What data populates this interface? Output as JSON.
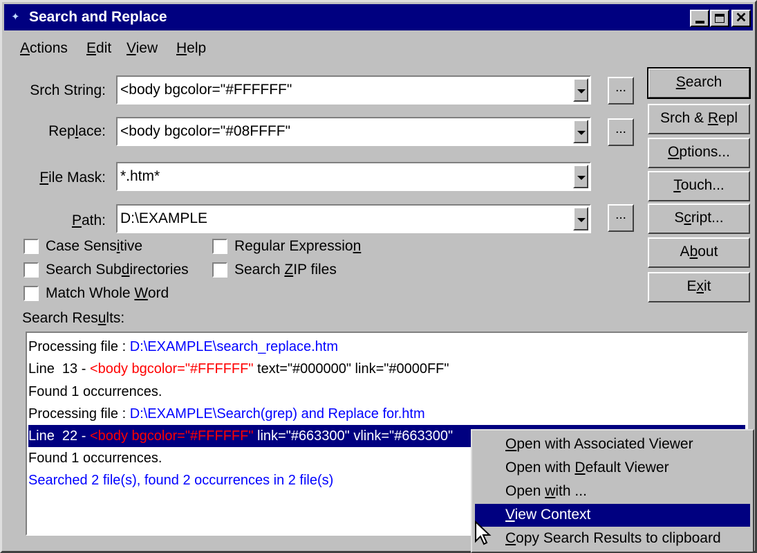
{
  "window": {
    "title": "Search and Replace",
    "icon": "app-icon"
  },
  "menu": [
    {
      "label": "Actions",
      "key": "A"
    },
    {
      "label": "Edit",
      "key": "E"
    },
    {
      "label": "View",
      "key": "V"
    },
    {
      "label": "Help",
      "key": "H"
    }
  ],
  "form": {
    "srch_string": {
      "label": "Srch String:",
      "value": "<body bgcolor=\"#FFFFFF\""
    },
    "replace": {
      "label": "Replace:",
      "value": "<body bgcolor=\"#08FFFF\""
    },
    "file_mask": {
      "label": "File Mask:",
      "value": "*.htm*"
    },
    "path": {
      "label": "Path:",
      "value": "D:\\EXAMPLE"
    },
    "browse_label": "..."
  },
  "options": {
    "case_sensitive": "Case Sensitive",
    "regular_expression": "Regular Expression",
    "search_subdirectories": "Search Subdirectories",
    "search_zip": "Search ZIP files",
    "match_whole_word": "Match Whole Word"
  },
  "buttons": {
    "search": "Search",
    "srch_repl": "Srch & Repl",
    "options": "Options...",
    "touch": "Touch...",
    "script": "Script...",
    "about": "About",
    "exit": "Exit"
  },
  "results": {
    "label": "Search Results:",
    "rows": [
      {
        "prefix": "Processing file : ",
        "path": "D:\\EXAMPLE\\search_replace.htm"
      },
      {
        "prefix": "Line  13 - ",
        "match": "<body bgcolor=\"#FFFFFF\"",
        "rest": " text=\"#000000\" link=\"#0000FF\""
      },
      {
        "text": "Found 1 occurrences."
      },
      {
        "prefix": "Processing file : ",
        "path": "D:\\EXAMPLE\\Search(grep) and Replace for.htm"
      },
      {
        "prefix": "Line  22 - ",
        "match": "<body bgcolor=\"#FFFFFF\"",
        "rest": " link=\"#663300\" vlink=\"#663300\""
      },
      {
        "text": "Found 1 occurrences."
      },
      {
        "summary": "Searched 2 file(s), found 2 occurrences in 2 file(s)"
      }
    ]
  },
  "context_menu": [
    "Open with Associated Viewer",
    "Open with Default Viewer",
    "Open with ...",
    "View Context",
    "Copy Search Results to clipboard"
  ],
  "colors": {
    "titlebar": "#000080",
    "face": "#c0c0c0",
    "link": "#0000ff",
    "match": "#ff0000",
    "selection": "#000080"
  }
}
